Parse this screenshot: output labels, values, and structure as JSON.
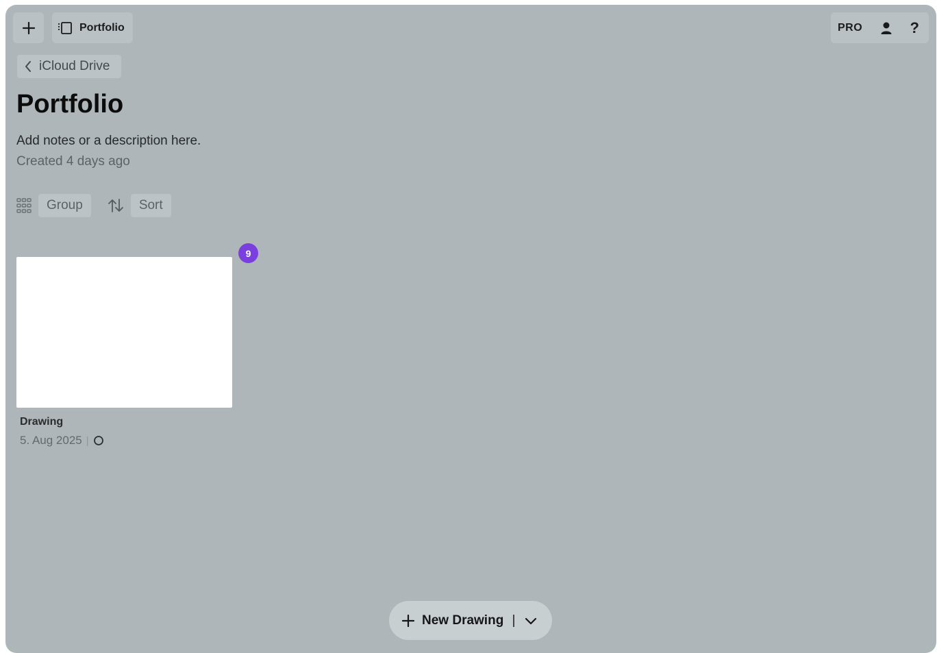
{
  "toolbar": {
    "folder_title": "Portfolio",
    "pro_label": "PRO",
    "help_label": "?"
  },
  "nav": {
    "back_label": "iCloud Drive"
  },
  "folder": {
    "title": "Portfolio",
    "description": "Add notes or a description here.",
    "created": "Created 4 days ago"
  },
  "controls": {
    "group_label": "Group",
    "sort_label": "Sort"
  },
  "items": [
    {
      "name": "Drawing",
      "date": "5. Aug 2025",
      "separator": "|",
      "badge": "9"
    }
  ],
  "new_drawing": {
    "label": "New Drawing"
  },
  "colors": {
    "background": "#aeb6b9",
    "badge": "#7b3fe0",
    "card": "#ffffff"
  }
}
